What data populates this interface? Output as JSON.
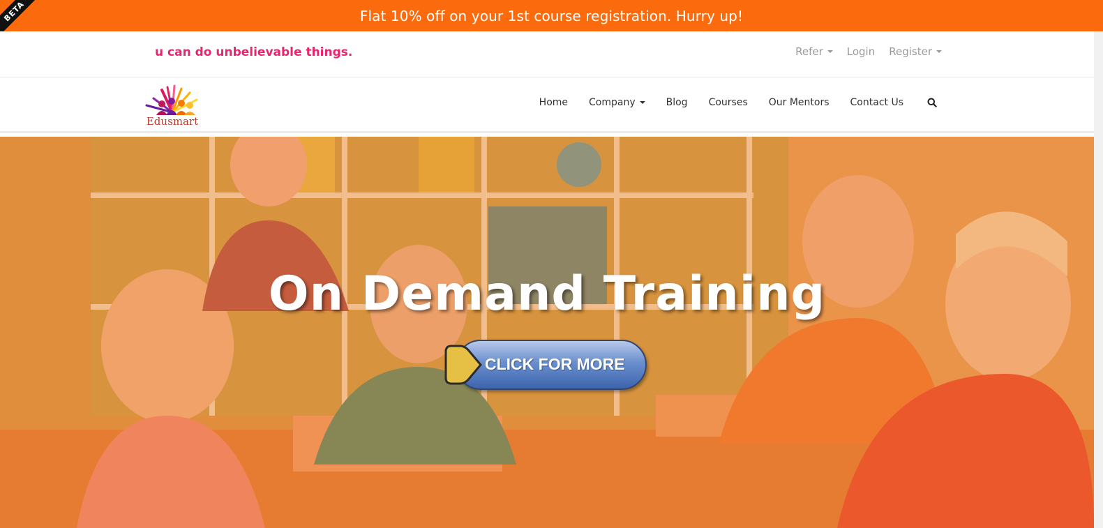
{
  "promo": {
    "text": "Flat 10% off on your 1st course registration. Hurry up!",
    "badge": "BETA",
    "color": "#fb6a0d"
  },
  "topbar": {
    "tagline": "u can do unbelievable things.",
    "links": [
      {
        "label": "Refer",
        "dropdown": true
      },
      {
        "label": "Login",
        "dropdown": false
      },
      {
        "label": "Register",
        "dropdown": true
      }
    ]
  },
  "brand": {
    "name": "Edusmart"
  },
  "nav": {
    "items": [
      {
        "label": "Home",
        "dropdown": false
      },
      {
        "label": "Company",
        "dropdown": true
      },
      {
        "label": "Blog",
        "dropdown": false
      },
      {
        "label": "Courses",
        "dropdown": false
      },
      {
        "label": "Our Mentors",
        "dropdown": false
      },
      {
        "label": "Contact Us",
        "dropdown": false
      }
    ],
    "search_icon": "search-icon"
  },
  "hero": {
    "title": "On Demand Training",
    "cta_label": "CLICK FOR MORE"
  }
}
